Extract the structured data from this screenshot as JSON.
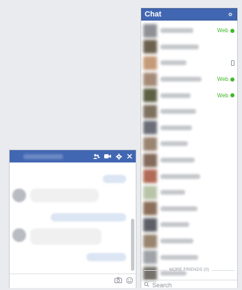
{
  "chat": {
    "title": "Chat",
    "friends": [
      {
        "avatar_color": "#8e9096",
        "name_width": 48,
        "status": "Web"
      },
      {
        "avatar_color": "#6d6250",
        "name_width": 56,
        "status": ""
      },
      {
        "avatar_color": "#c49a78",
        "name_width": 38,
        "status": "mobile"
      },
      {
        "avatar_color": "#a58b77",
        "name_width": 60,
        "status": "Web"
      },
      {
        "avatar_color": "#5e6045",
        "name_width": 44,
        "status": "Web"
      },
      {
        "avatar_color": "#7f7160",
        "name_width": 52,
        "status": ""
      },
      {
        "avatar_color": "#6b6e78",
        "name_width": 46,
        "status": ""
      },
      {
        "avatar_color": "#9a8570",
        "name_width": 40,
        "status": ""
      },
      {
        "avatar_color": "#836a5c",
        "name_width": 50,
        "status": ""
      },
      {
        "avatar_color": "#b06a55",
        "name_width": 58,
        "status": ""
      },
      {
        "avatar_color": "#b8c4a8",
        "name_width": 36,
        "status": ""
      },
      {
        "avatar_color": "#8b6f5a",
        "name_width": 54,
        "status": ""
      },
      {
        "avatar_color": "#5d5e66",
        "name_width": 42,
        "status": ""
      },
      {
        "avatar_color": "#98846f",
        "name_width": 48,
        "status": ""
      },
      {
        "avatar_color": "#a0a3a8",
        "name_width": 55,
        "status": ""
      },
      {
        "avatar_color": "#75706a",
        "name_width": 38,
        "status": ""
      }
    ],
    "more_friends_label": "MORE FRIENDS (0)",
    "search_placeholder": "Search"
  },
  "colors": {
    "header": "#4267b2",
    "online": "#42b72a"
  },
  "icons": {
    "chat_settings": "gear-icon",
    "conv_add_people": "add-people-icon",
    "conv_video": "video-call-icon",
    "conv_settings": "gear-icon",
    "conv_close": "close-icon",
    "footer_camera": "camera-icon",
    "footer_emoji": "emoji-icon",
    "search": "search-icon"
  }
}
